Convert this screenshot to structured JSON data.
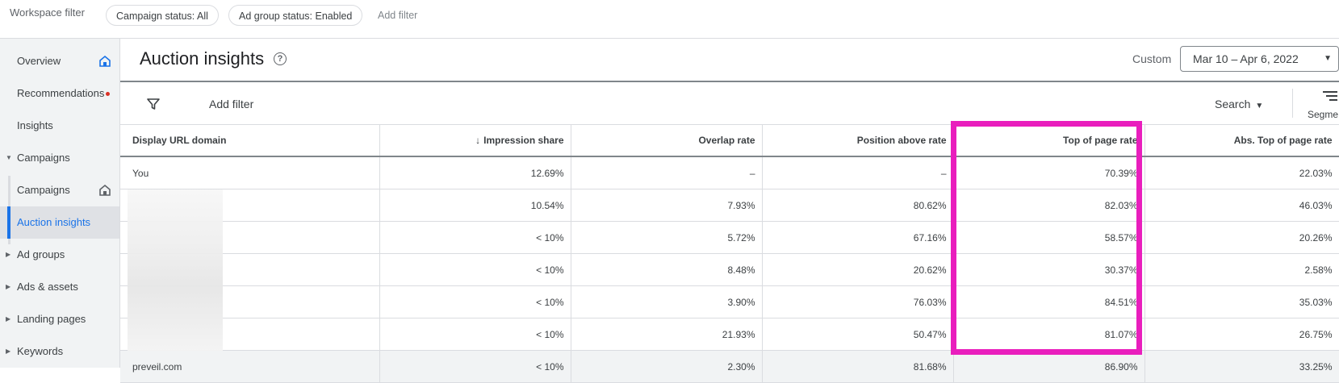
{
  "topbar": {
    "workspace_label": "Workspace filter",
    "chips": [
      "Campaign status: All",
      "Ad group status: Enabled"
    ],
    "add_filter": "Add filter"
  },
  "sidebar": {
    "items": [
      {
        "label": "Overview"
      },
      {
        "label": "Recommendations"
      },
      {
        "label": "Insights"
      },
      {
        "label": "Campaigns"
      },
      {
        "label": "Campaigns"
      },
      {
        "label": "Auction insights"
      },
      {
        "label": "Ad groups"
      },
      {
        "label": "Ads & assets"
      },
      {
        "label": "Landing pages"
      },
      {
        "label": "Keywords"
      }
    ]
  },
  "header": {
    "title": "Auction insights",
    "custom_label": "Custom",
    "date_range": "Mar 10 – Apr 6, 2022"
  },
  "filterbar": {
    "add_filter": "Add filter",
    "search_select": "Search",
    "segment_label": "Segme"
  },
  "table": {
    "columns": [
      "Display URL domain",
      "Impression share",
      "Overlap rate",
      "Position above rate",
      "Top of page rate",
      "Abs. Top of page rate"
    ],
    "rows": [
      [
        "You",
        "12.69%",
        "–",
        "–",
        "70.39%",
        "22.03%"
      ],
      [
        "",
        "10.54%",
        "7.93%",
        "80.62%",
        "82.03%",
        "46.03%"
      ],
      [
        "",
        "< 10%",
        "5.72%",
        "67.16%",
        "58.57%",
        "20.26%"
      ],
      [
        "",
        "< 10%",
        "8.48%",
        "20.62%",
        "30.37%",
        "2.58%"
      ],
      [
        "",
        "< 10%",
        "3.90%",
        "76.03%",
        "84.51%",
        "35.03%"
      ],
      [
        "",
        "< 10%",
        "21.93%",
        "50.47%",
        "81.07%",
        "26.75%"
      ],
      [
        "preveil.com",
        "< 10%",
        "2.30%",
        "81.68%",
        "86.90%",
        "33.25%"
      ]
    ]
  },
  "colors": {
    "accent": "#1a73e8",
    "highlight": "#e91ebd",
    "alert_dot": "#d93025"
  }
}
